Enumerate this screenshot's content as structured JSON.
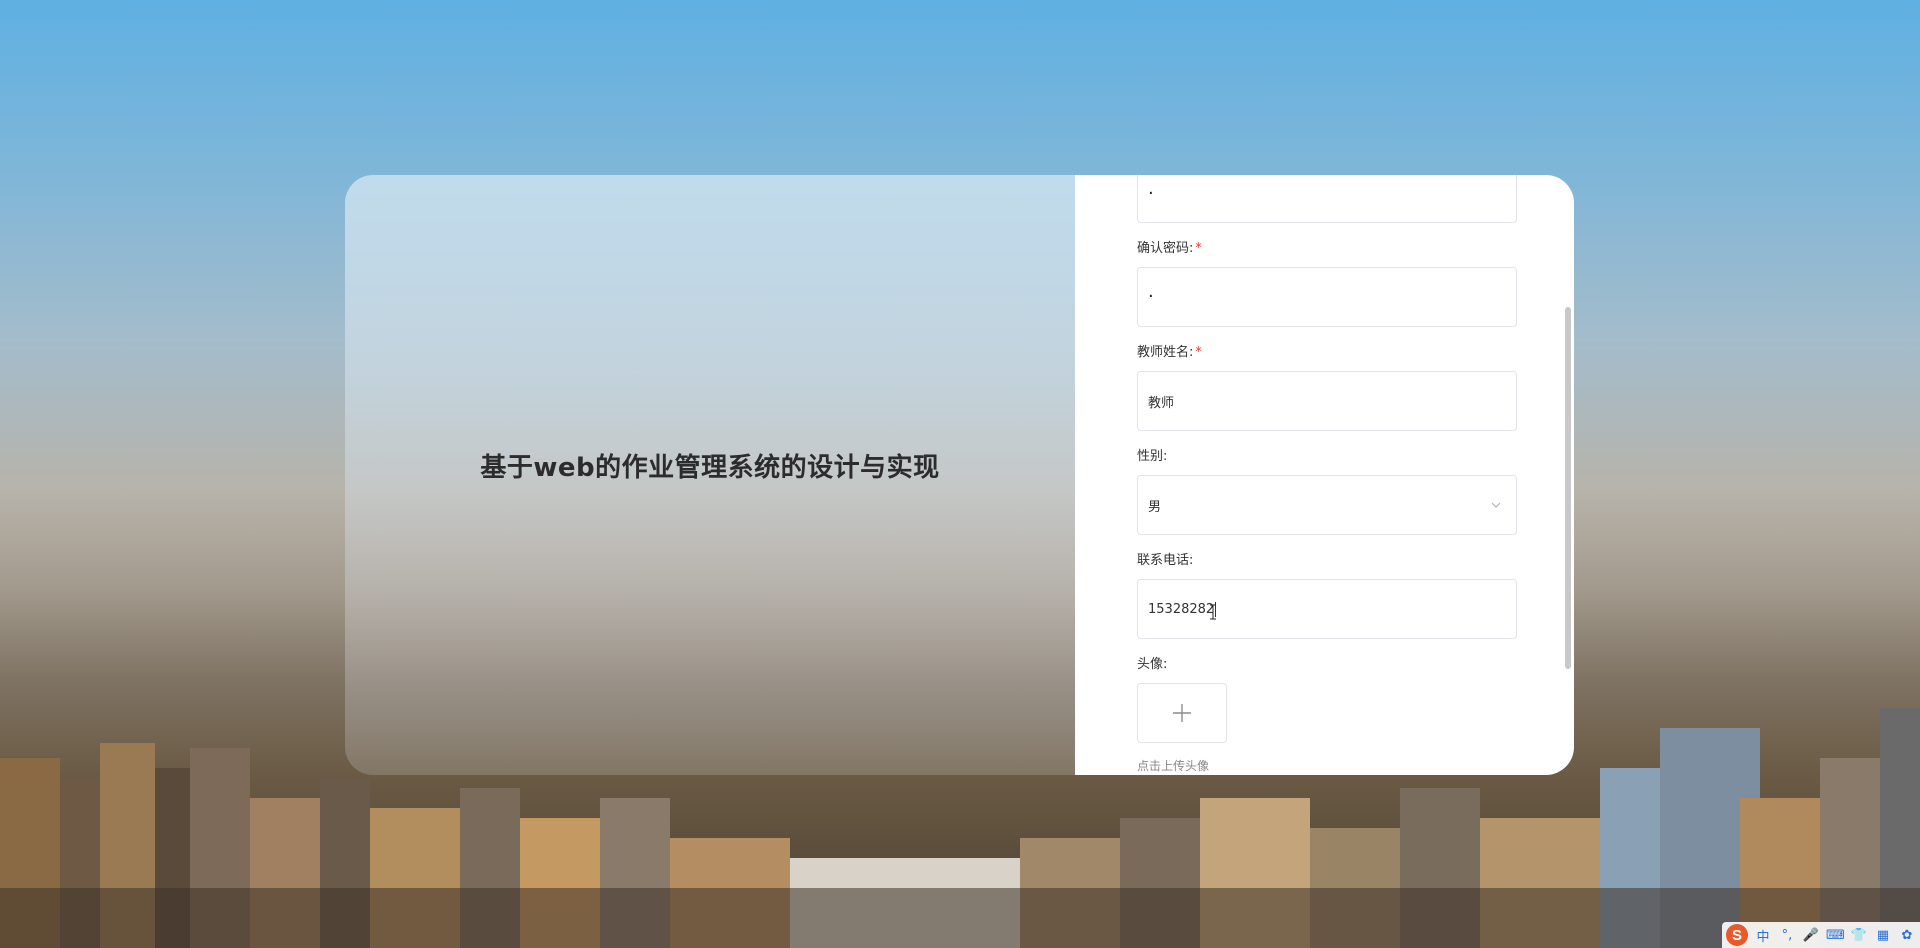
{
  "app": {
    "title": "基于web的作业管理系统的设计与实现"
  },
  "form": {
    "password": {
      "value": "·"
    },
    "confirm_password": {
      "label": "确认密码:",
      "required_mark": "*",
      "value": "·"
    },
    "teacher_name": {
      "label": "教师姓名:",
      "required_mark": "*",
      "value": "教师"
    },
    "gender": {
      "label": "性别:",
      "selected": "男"
    },
    "phone": {
      "label": "联系电话:",
      "value": "15328282"
    },
    "avatar": {
      "label": "头像:",
      "hint": "点击上传头像"
    }
  },
  "tray": {
    "ime_icon": "sogou-ime-icon",
    "items": [
      "中",
      "°,",
      "🎤",
      "⌨",
      "👕",
      "▦",
      "✿"
    ]
  },
  "colors": {
    "required": "#e23c3c",
    "border": "#e2e4ea",
    "title": "#2c2c2c"
  }
}
